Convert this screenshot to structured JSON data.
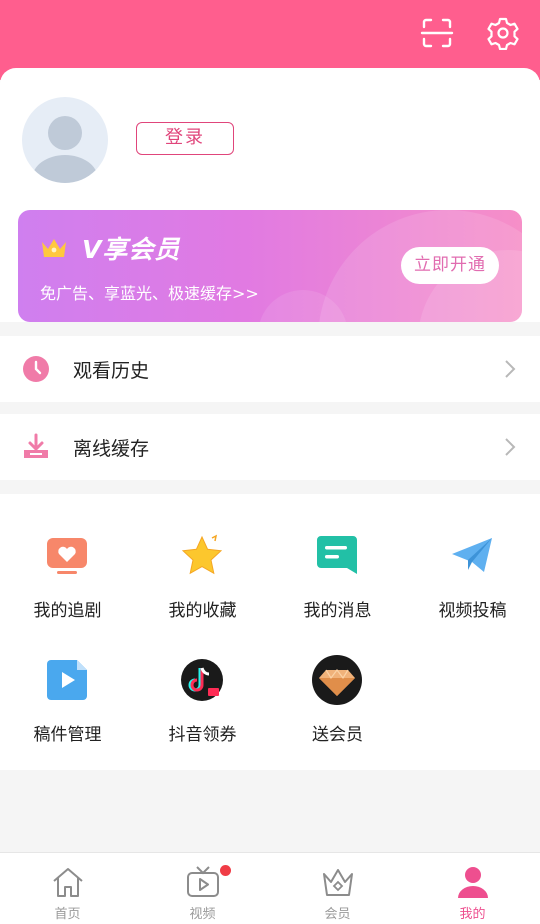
{
  "header": {
    "icons": [
      "scan-icon",
      "settings-icon"
    ],
    "background_color": "#ff5e8e"
  },
  "profile": {
    "login_label": "登录",
    "avatar_icon": "default-avatar-icon"
  },
  "vip_banner": {
    "title": "V享会员",
    "subtitle": "免广告、享蓝光、极速缓存>>",
    "button_label": "立即开通",
    "icon": "crown-icon"
  },
  "menu": {
    "items": [
      {
        "label": "观看历史",
        "icon": "clock-icon"
      },
      {
        "label": "离线缓存",
        "icon": "download-icon"
      }
    ]
  },
  "grid": {
    "items": [
      {
        "label": "我的追剧",
        "icon": "tv-heart-icon"
      },
      {
        "label": "我的收藏",
        "icon": "star-icon"
      },
      {
        "label": "我的消息",
        "icon": "message-icon"
      },
      {
        "label": "视频投稿",
        "icon": "paper-plane-icon"
      },
      {
        "label": "稿件管理",
        "icon": "video-file-icon"
      },
      {
        "label": "抖音领券",
        "icon": "douyin-coupon-icon"
      },
      {
        "label": "送会员",
        "icon": "diamond-icon"
      }
    ]
  },
  "tabbar": {
    "tabs": [
      {
        "label": "首页",
        "icon": "home-icon"
      },
      {
        "label": "视频",
        "icon": "tv-play-icon",
        "badge": true
      },
      {
        "label": "会员",
        "icon": "crown-outline-icon"
      },
      {
        "label": "我的",
        "icon": "user-icon",
        "active": true
      }
    ],
    "active_color": "#ee4f8f"
  }
}
